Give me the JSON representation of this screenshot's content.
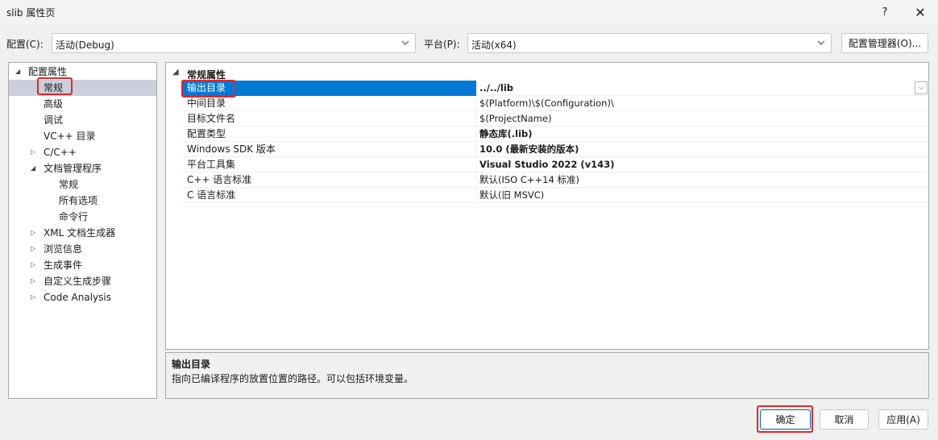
{
  "window": {
    "title": "slib 属性页",
    "help_label": "?",
    "close_label": "✕"
  },
  "toolbar": {
    "config_label": "配置(C):",
    "config_value": "活动(Debug)",
    "platform_label": "平台(P):",
    "platform_value": "活动(x64)",
    "config_manager_label": "配置管理器(O)..."
  },
  "tree": {
    "items": [
      {
        "label": "配置属性",
        "arrow": "◢"
      },
      {
        "label": "常规",
        "arrow": ""
      },
      {
        "label": "高级",
        "arrow": ""
      },
      {
        "label": "调试",
        "arrow": ""
      },
      {
        "label": "VC++ 目录",
        "arrow": ""
      },
      {
        "label": "C/C++",
        "arrow": "▷"
      },
      {
        "label": "文档管理程序",
        "arrow": "◢"
      },
      {
        "label": "常规",
        "arrow": ""
      },
      {
        "label": "所有选项",
        "arrow": ""
      },
      {
        "label": "命令行",
        "arrow": ""
      },
      {
        "label": "XML 文档生成器",
        "arrow": "▷"
      },
      {
        "label": "浏览信息",
        "arrow": "▷"
      },
      {
        "label": "生成事件",
        "arrow": "▷"
      },
      {
        "label": "自定义生成步骤",
        "arrow": "▷"
      },
      {
        "label": "Code Analysis",
        "arrow": "▷"
      }
    ]
  },
  "grid": {
    "category": "常规属性",
    "category_arrow": "◢",
    "dropdown_glyph": "⌵",
    "rows": [
      {
        "name": "输出目录",
        "value": "../../lib"
      },
      {
        "name": "中间目录",
        "value": "$(Platform)\\$(Configuration)\\"
      },
      {
        "name": "目标文件名",
        "value": "$(ProjectName)"
      },
      {
        "name": "配置类型",
        "value": "静态库(.lib)"
      },
      {
        "name": "Windows SDK 版本",
        "value": "10.0 (最新安装的版本)"
      },
      {
        "name": "平台工具集",
        "value": "Visual Studio 2022 (v143)"
      },
      {
        "name": "C++ 语言标准",
        "value": "默认(ISO C++14 标准)"
      },
      {
        "name": "C 语言标准",
        "value": "默认(旧 MSVC)"
      }
    ]
  },
  "description": {
    "title": "输出目录",
    "text": "指向已编译程序的放置位置的路径。可以包括环境变量。"
  },
  "buttons": {
    "ok": "确定",
    "cancel": "取消",
    "apply": "应用(A)"
  },
  "colors": {
    "selection": "#0078d4",
    "highlight_box": "#e0282a",
    "tree_selection": "#cccedb"
  }
}
